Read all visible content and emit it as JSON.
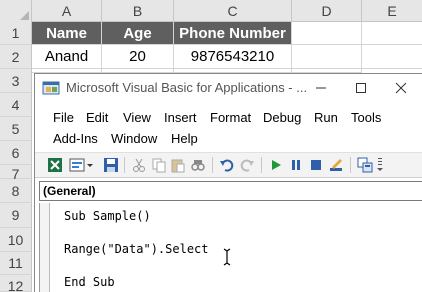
{
  "excel": {
    "columns": [
      "A",
      "B",
      "C",
      "D",
      "E"
    ],
    "rows": [
      "1",
      "2",
      "3",
      "4",
      "5",
      "6",
      "7",
      "8",
      "9",
      "10",
      "11",
      "12"
    ],
    "table": {
      "headers": [
        "Name",
        "Age",
        "Phone Number"
      ],
      "row": [
        "Anand",
        "20",
        "9876543210"
      ]
    },
    "colors": {
      "header_fill": "#5f5f5f",
      "header_text": "#ffffff"
    }
  },
  "vba": {
    "title": "Microsoft Visual Basic for Applications - ...",
    "menu": {
      "file": "File",
      "edit": "Edit",
      "view": "View",
      "insert": "Insert",
      "format": "Format",
      "debug": "Debug",
      "run": "Run",
      "tools": "Tools",
      "addins": "Add-Ins",
      "window": "Window",
      "help": "Help"
    },
    "toolbar_icons": [
      "excel-icon",
      "insert-module-icon",
      "dropdown-arrow-icon",
      "save-icon",
      "cut-icon",
      "copy-icon",
      "paste-icon",
      "find-icon",
      "undo-icon",
      "redo-icon",
      "run-icon",
      "break-icon",
      "reset-icon",
      "design-mode-icon",
      "project-explorer-icon"
    ],
    "object_combo": "(General)",
    "code": [
      "Sub Sample()",
      "Range(\"Data\").Select",
      "End Sub"
    ]
  }
}
